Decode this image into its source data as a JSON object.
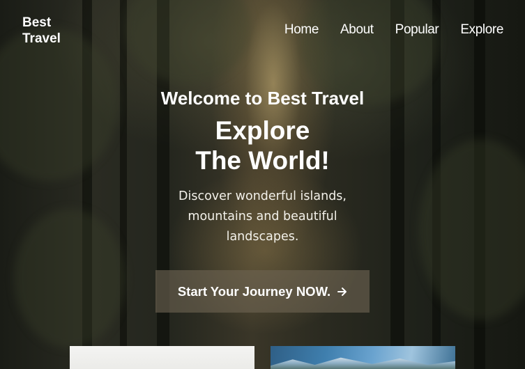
{
  "brand": {
    "name": "Best Travel"
  },
  "nav": {
    "items": [
      "Home",
      "About",
      "Popular",
      "Explore"
    ]
  },
  "hero": {
    "welcome": "Welcome to Best Travel",
    "headline_line1": "Explore",
    "headline_line2": "The World!",
    "subtext": "Discover wonderful islands, mountains and beautiful landscapes.",
    "cta_label": "Start Your Journey NOW."
  },
  "icons": {
    "cta_icon": "arrow-right-icon"
  },
  "colors": {
    "text": "#ffffff",
    "cta_background": "#6e6452"
  }
}
